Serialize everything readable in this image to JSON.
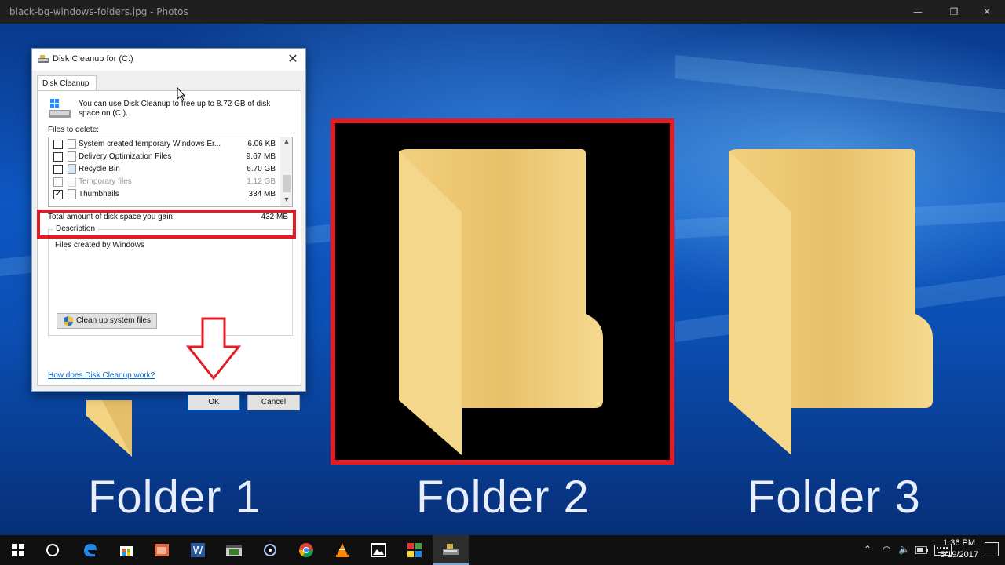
{
  "window": {
    "title": "black-bg-windows-folders.jpg - Photos",
    "minimize_glyph": "—",
    "restore_glyph": "❐",
    "close_glyph": "✕"
  },
  "photo": {
    "folders": [
      {
        "label": "Folder 1"
      },
      {
        "label": "Folder 2"
      },
      {
        "label": "Folder 3"
      }
    ]
  },
  "dialog": {
    "title": "Disk Cleanup for  (C:)",
    "tab": "Disk Cleanup",
    "intro": "You can use Disk Cleanup to free up to 8.72 GB of disk space on  (C:).",
    "files_label": "Files to delete:",
    "files": [
      {
        "name": "System created temporary Windows Er...",
        "size": "6.06 KB",
        "checked": false
      },
      {
        "name": "Delivery Optimization Files",
        "size": "9.67 MB",
        "checked": false
      },
      {
        "name": "Recycle Bin",
        "size": "6.70 GB",
        "checked": false
      },
      {
        "name": "Temporary files",
        "size": "1.12 GB",
        "checked": false
      },
      {
        "name": "Thumbnails",
        "size": "334 MB",
        "checked": true
      }
    ],
    "total_label": "Total amount of disk space you gain:",
    "total_value": "432 MB",
    "description_legend": "Description",
    "description_text": "Files created by Windows",
    "cleanup_system_button": "Clean up system files",
    "help_link": "How does Disk Cleanup work?",
    "ok_button": "OK",
    "cancel_button": "Cancel",
    "close_glyph": "✕"
  },
  "taskbar": {
    "time": "1:36 PM",
    "date": "5/19/2017",
    "icons": [
      "windows-start-icon",
      "cortana-icon",
      "edge-icon",
      "store-icon",
      "calendar-app-icon",
      "word-icon",
      "video-editor-icon",
      "network-app-icon",
      "chrome-icon",
      "vlc-icon",
      "photos-icon",
      "tiles-app-icon",
      "disk-cleanup-icon"
    ],
    "tray_up_glyph": "⌃",
    "tray_wifi_glyph": "◠",
    "tray_volume_glyph": "🔈"
  },
  "colors": {
    "highlight": "#e21b24",
    "folder_light": "#f3d483",
    "folder_dark": "#e4b75c",
    "accent": "#0078d7"
  }
}
